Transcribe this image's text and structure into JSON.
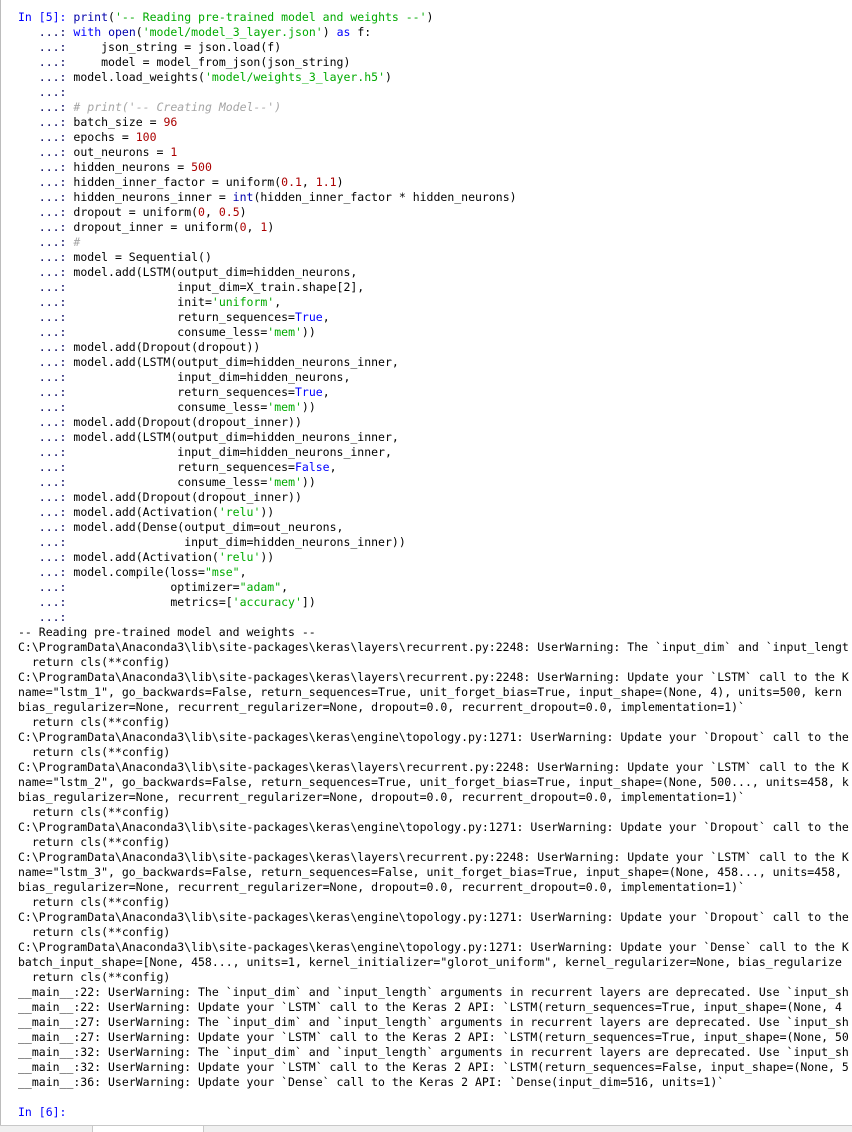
{
  "prompt_in_5": "In [5]:",
  "prompt_in_6": "In [6]:",
  "prompt_cont": "...:",
  "code": {
    "l1_fn": "print",
    "l1_str": "'-- Reading pre-trained model and weights --'",
    "l2_kw": "with",
    "l2_fn": "open",
    "l2_str1": "'model/model_3_layer.json'",
    "l2_kw2": "as",
    "l2_rest": " f:",
    "l3": "    json_string = json.load(f)",
    "l4": "    model = model_from_json(json_string)",
    "l5_a": "model.load_weights(",
    "l5_str": "'model/weights_3_layer.h5'",
    "l5_b": ")",
    "l7_cmt": "# print('-- Creating Model--')",
    "l8_a": "batch_size = ",
    "l8_n": "96",
    "l9_a": "epochs = ",
    "l9_n": "100",
    "l10_a": "out_neurons = ",
    "l10_n": "1",
    "l11_a": "hidden_neurons = ",
    "l11_n": "500",
    "l12_a": "hidden_inner_factor = uniform(",
    "l12_n1": "0.1",
    "l12_n2": "1.1",
    "l13_a": "hidden_neurons_inner = ",
    "l13_fn": "int",
    "l13_b": "(hidden_inner_factor * hidden_neurons)",
    "l14_a": "dropout = uniform(",
    "l14_n1": "0",
    "l14_n2": "0.5",
    "l15_a": "dropout_inner = uniform(",
    "l15_n1": "0",
    "l15_n2": "1",
    "l16_cmt": "#",
    "l17": "model = Sequential()",
    "l18": "model.add(LSTM(output_dim=hidden_neurons,",
    "l19": "               input_dim=X_train.shape[2],",
    "l20_a": "               init=",
    "l20_str": "'uniform'",
    "l21_a": "               return_sequences=",
    "l21_kw": "True",
    "l22_a": "               consume_less=",
    "l22_str": "'mem'",
    "l22_b": "))",
    "l23": "model.add(Dropout(dropout))",
    "l24": "model.add(LSTM(output_dim=hidden_neurons_inner,",
    "l25": "               input_dim=hidden_neurons,",
    "l26_a": "               return_sequences=",
    "l26_kw": "True",
    "l27_a": "               consume_less=",
    "l27_str": "'mem'",
    "l27_b": "))",
    "l28": "model.add(Dropout(dropout_inner))",
    "l29": "model.add(LSTM(output_dim=hidden_neurons_inner,",
    "l30": "               input_dim=hidden_neurons_inner,",
    "l31_a": "               return_sequences=",
    "l31_kw": "False",
    "l32_a": "               consume_less=",
    "l32_str": "'mem'",
    "l32_b": "))",
    "l33": "model.add(Dropout(dropout_inner))",
    "l34_a": "model.add(Activation(",
    "l34_str": "'relu'",
    "l34_b": "))",
    "l35": "model.add(Dense(output_dim=out_neurons,",
    "l36": "                input_dim=hidden_neurons_inner))",
    "l37_a": "model.add(Activation(",
    "l37_str": "'relu'",
    "l37_b": "))",
    "l38_a": "model.compile(loss=",
    "l38_str": "\"mse\"",
    "l39_a": "              optimizer=",
    "l39_str": "\"adam\"",
    "l40_a": "              metrics=[",
    "l40_str": "'accuracy'",
    "l40_b": "])"
  },
  "output": [
    "-- Reading pre-trained model and weights --",
    "C:\\ProgramData\\Anaconda3\\lib\\site-packages\\keras\\layers\\recurrent.py:2248: UserWarning: The `input_dim` and `input_lengt",
    "  return cls(**config)",
    "C:\\ProgramData\\Anaconda3\\lib\\site-packages\\keras\\layers\\recurrent.py:2248: UserWarning: Update your `LSTM` call to the K",
    "name=\"lstm_1\", go_backwards=False, return_sequences=True, unit_forget_bias=True, input_shape=(None, 4), units=500, kern",
    "bias_regularizer=None, recurrent_regularizer=None, dropout=0.0, recurrent_dropout=0.0, implementation=1)`",
    "  return cls(**config)",
    "C:\\ProgramData\\Anaconda3\\lib\\site-packages\\keras\\engine\\topology.py:1271: UserWarning: Update your `Dropout` call to the",
    "  return cls(**config)",
    "C:\\ProgramData\\Anaconda3\\lib\\site-packages\\keras\\layers\\recurrent.py:2248: UserWarning: Update your `LSTM` call to the K",
    "name=\"lstm_2\", go_backwards=False, return_sequences=True, unit_forget_bias=True, input_shape=(None, 500..., units=458, k",
    "bias_regularizer=None, recurrent_regularizer=None, dropout=0.0, recurrent_dropout=0.0, implementation=1)`",
    "  return cls(**config)",
    "C:\\ProgramData\\Anaconda3\\lib\\site-packages\\keras\\engine\\topology.py:1271: UserWarning: Update your `Dropout` call to the",
    "  return cls(**config)",
    "C:\\ProgramData\\Anaconda3\\lib\\site-packages\\keras\\layers\\recurrent.py:2248: UserWarning: Update your `LSTM` call to the K",
    "name=\"lstm_3\", go_backwards=False, return_sequences=False, unit_forget_bias=True, input_shape=(None, 458..., units=458,",
    "bias_regularizer=None, recurrent_regularizer=None, dropout=0.0, recurrent_dropout=0.0, implementation=1)`",
    "  return cls(**config)",
    "C:\\ProgramData\\Anaconda3\\lib\\site-packages\\keras\\engine\\topology.py:1271: UserWarning: Update your `Dropout` call to the",
    "  return cls(**config)",
    "C:\\ProgramData\\Anaconda3\\lib\\site-packages\\keras\\engine\\topology.py:1271: UserWarning: Update your `Dense` call to the K",
    "batch_input_shape=[None, 458..., units=1, kernel_initializer=\"glorot_uniform\", kernel_regularizer=None, bias_regularize",
    "  return cls(**config)",
    "__main__:22: UserWarning: The `input_dim` and `input_length` arguments in recurrent layers are deprecated. Use `input_sh",
    "__main__:22: UserWarning: Update your `LSTM` call to the Keras 2 API: `LSTM(return_sequences=True, input_shape=(None, 4",
    "__main__:27: UserWarning: The `input_dim` and `input_length` arguments in recurrent layers are deprecated. Use `input_sh",
    "__main__:27: UserWarning: Update your `LSTM` call to the Keras 2 API: `LSTM(return_sequences=True, input_shape=(None, 50",
    "__main__:32: UserWarning: The `input_dim` and `input_length` arguments in recurrent layers are deprecated. Use `input_sh",
    "__main__:32: UserWarning: Update your `LSTM` call to the Keras 2 API: `LSTM(return_sequences=False, input_shape=(None, 5",
    "__main__:36: UserWarning: Update your `Dense` call to the Keras 2 API: `Dense(input_dim=516, units=1)`"
  ],
  "colors": {
    "prompt": "#0000ff",
    "keyword": "#0000ff",
    "string": "#00aa00",
    "number": "#aa0000",
    "comment": "#a5a5a5"
  }
}
